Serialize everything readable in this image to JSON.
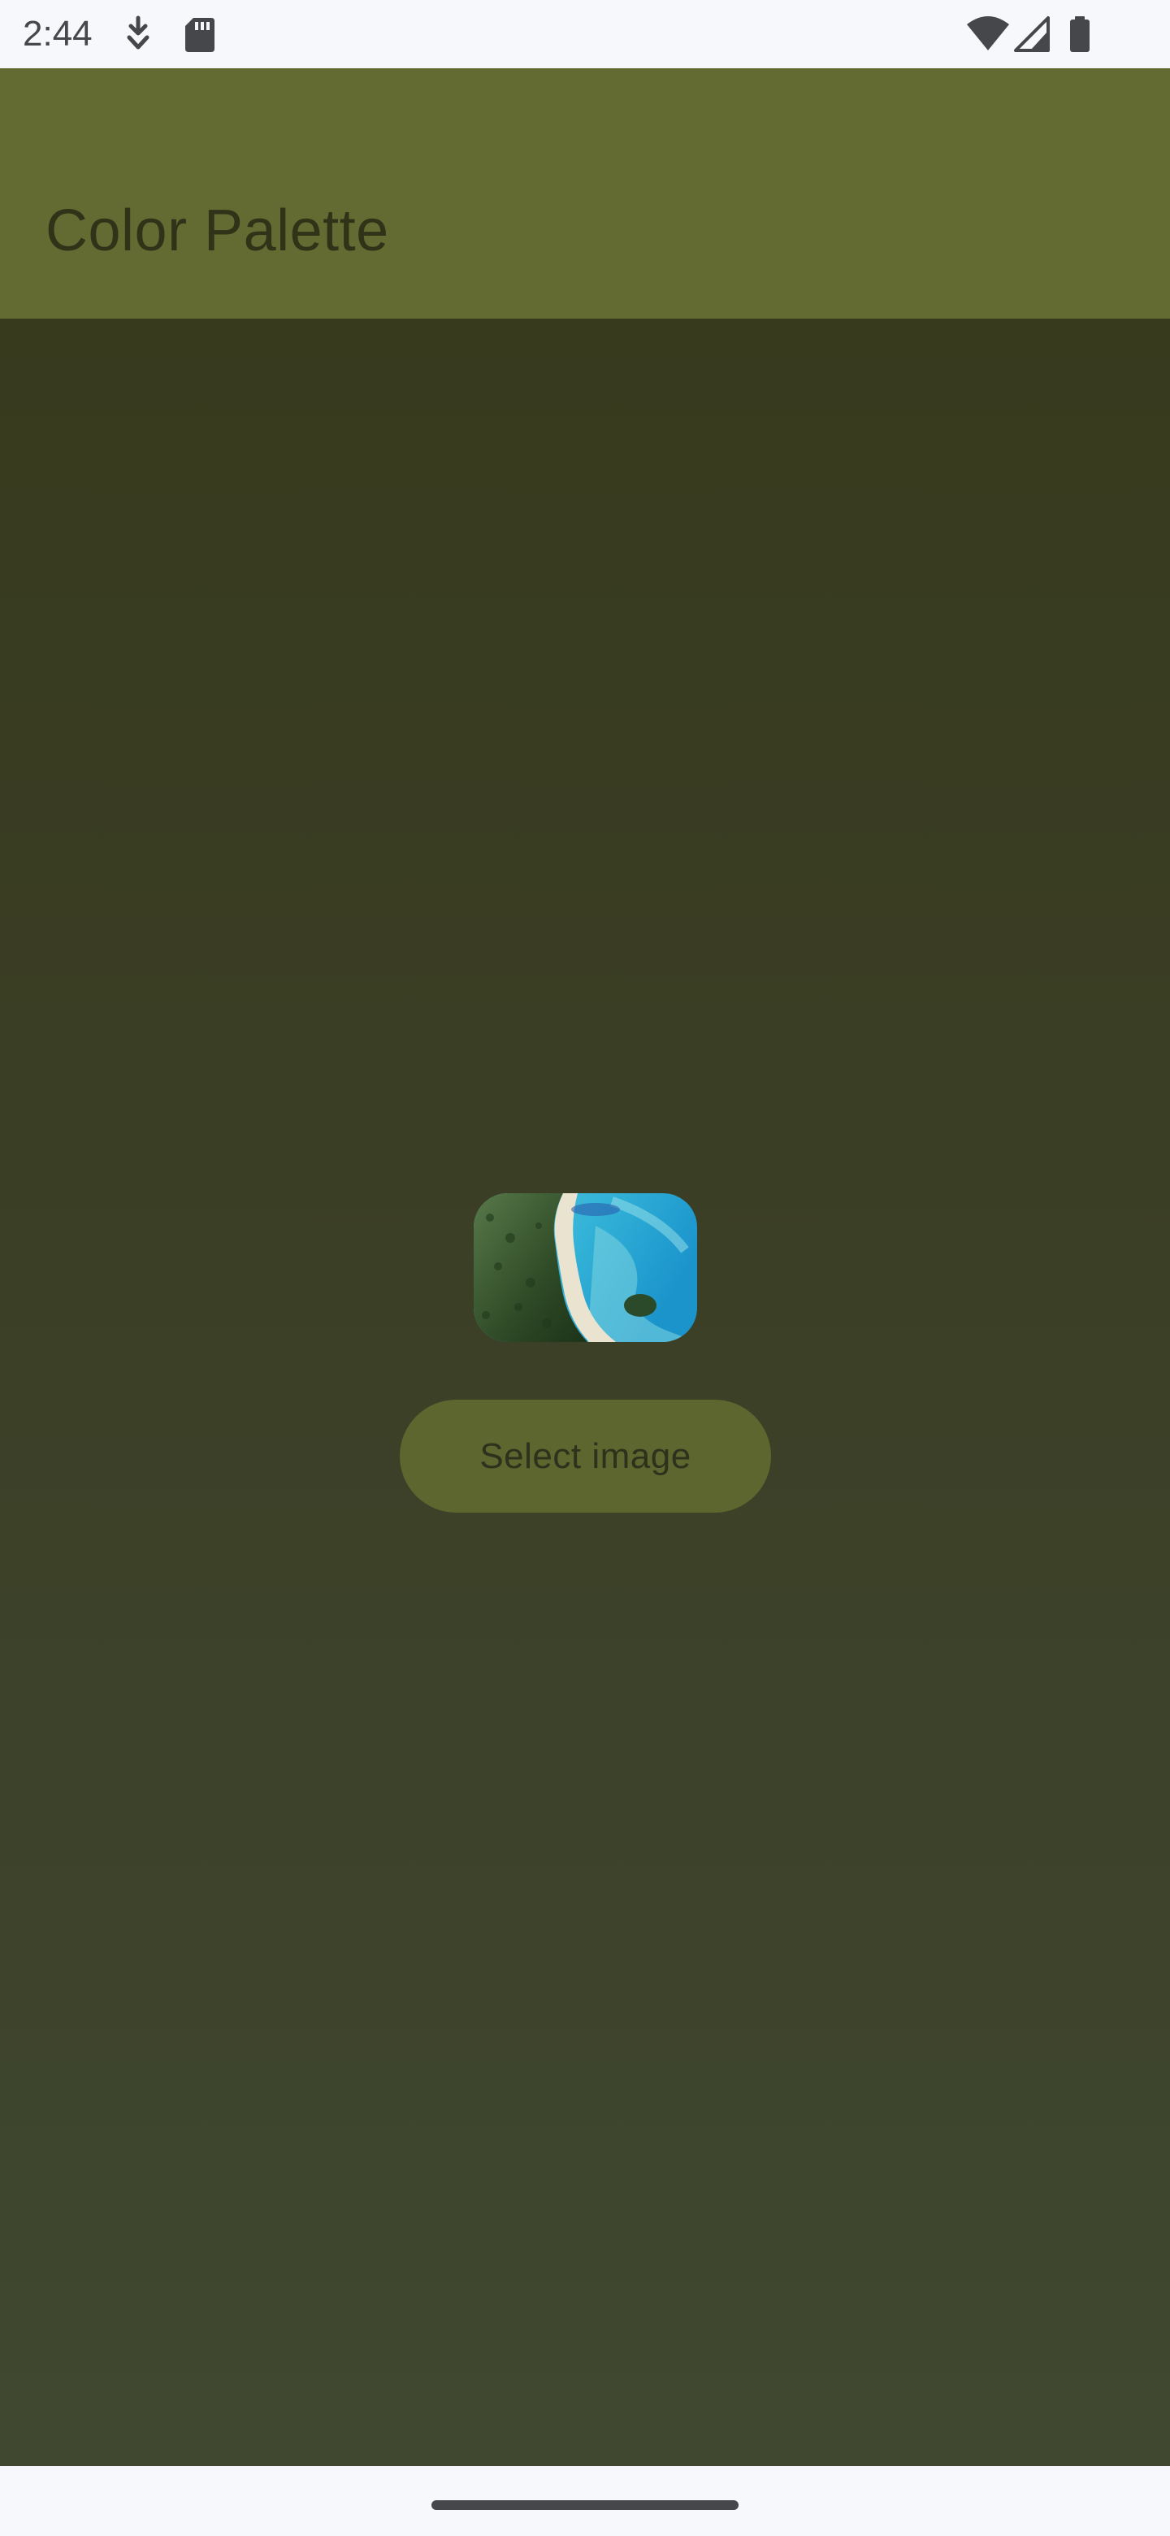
{
  "status_bar": {
    "time": "2:44",
    "icons": [
      "download-icon",
      "sd-card-icon",
      "wifi-icon",
      "cell-signal-icon",
      "battery-icon"
    ]
  },
  "app_bar": {
    "title": "Color Palette"
  },
  "main": {
    "image": {
      "description_icon": "beach-thumbnail-image"
    },
    "select_button_label": "Select image"
  },
  "colors": {
    "status_bar_bg": "#f7f8fc",
    "app_bar_bg": "#636b32",
    "content_bg_top": "#373a1d",
    "content_bg_bottom": "#404830",
    "button_bg": "#5e662f",
    "button_text": "#2e311b",
    "title_text": "#303318"
  }
}
